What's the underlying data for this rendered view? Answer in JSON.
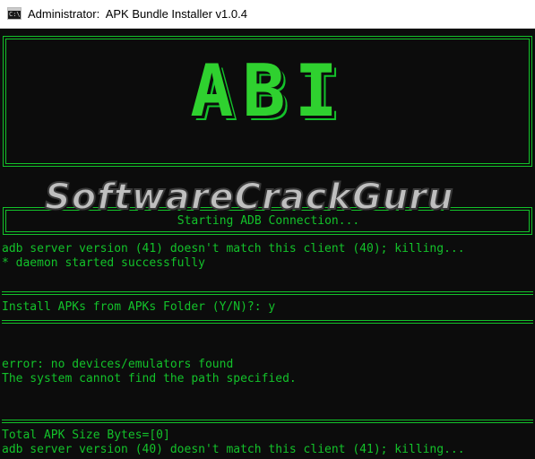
{
  "window": {
    "title": "Administrator:  APK Bundle Installer v1.0.4",
    "icon": "cmd-console-icon"
  },
  "console": {
    "logo_text": "ABI",
    "status_banner": "Starting ADB Connection...",
    "block1": [
      "adb server version (41) doesn't match this client (40); killing...",
      "* daemon started successfully"
    ],
    "prompt": "Install APKs from APKs Folder (Y/N)?: y",
    "block2": [
      "error: no devices/emulators found",
      "The system cannot find the path specified."
    ],
    "block3": [
      "Total APK Size Bytes=[0]",
      "adb server version (40) doesn't match this client (41); killing..."
    ]
  },
  "watermark": "SoftwareCrackGuru",
  "colors": {
    "console_bg": "#0c0c0c",
    "console_green": "#13c22a",
    "titlebar_bg": "#ffffff"
  }
}
